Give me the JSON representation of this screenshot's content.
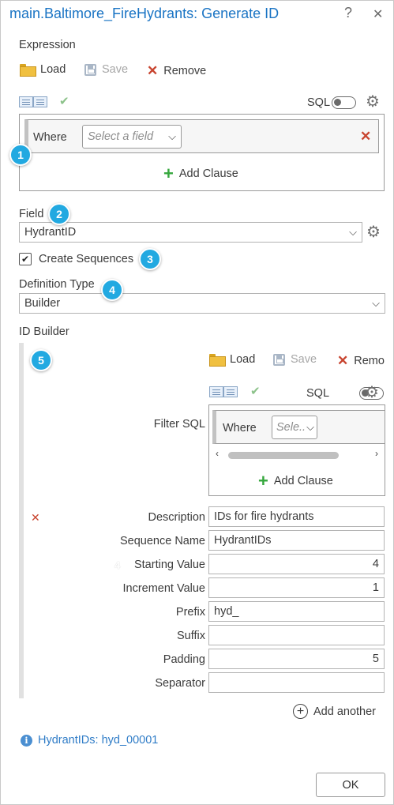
{
  "window": {
    "title": "main.Baltimore_FireHydrants: Generate ID",
    "help_label": "?",
    "close_label": "✕"
  },
  "expression": {
    "section_label": "Expression",
    "load_label": "Load",
    "save_label": "Save",
    "remove_label": "Remove",
    "sql_label": "SQL",
    "where_label": "Where",
    "field_placeholder": "Select a field",
    "add_clause_label": "Add Clause"
  },
  "field": {
    "label": "Field",
    "value": "HydrantID"
  },
  "create_sequences": {
    "label": "Create Sequences",
    "checked": true
  },
  "definition_type": {
    "label": "Definition Type",
    "value": "Builder"
  },
  "id_builder": {
    "label": "ID Builder",
    "load_label": "Load",
    "save_label": "Save",
    "remove_label": "Remo",
    "sql_label": "SQL",
    "filter_sql_label": "Filter SQL",
    "where_label": "Where",
    "field_placeholder": "Sele..",
    "add_clause_label": "Add Clause",
    "fields": [
      {
        "label": "Description",
        "value": "IDs for fire hydrants",
        "numeric": false
      },
      {
        "label": "Sequence Name",
        "value": "HydrantIDs",
        "numeric": false
      },
      {
        "label": "Starting Value",
        "value": "4",
        "numeric": true
      },
      {
        "label": "Increment Value",
        "value": "1",
        "numeric": true
      },
      {
        "label": "Prefix",
        "value": "hyd_",
        "numeric": false
      },
      {
        "label": "Suffix",
        "value": "",
        "numeric": false
      },
      {
        "label": "Padding",
        "value": "5",
        "numeric": true
      },
      {
        "label": "Separator",
        "value": "",
        "numeric": false
      }
    ],
    "add_another_label": "Add another"
  },
  "preview": {
    "text": "HydrantIDs: hyd_00001",
    "color": "#2f7cc7"
  },
  "badges": [
    "1",
    "2",
    "3",
    "4",
    "5"
  ],
  "ok_label": "OK",
  "colors": {
    "accent": "#1a74c4",
    "badge": "#22a9e1",
    "remove": "#c8442f",
    "add": "#35a73d"
  }
}
